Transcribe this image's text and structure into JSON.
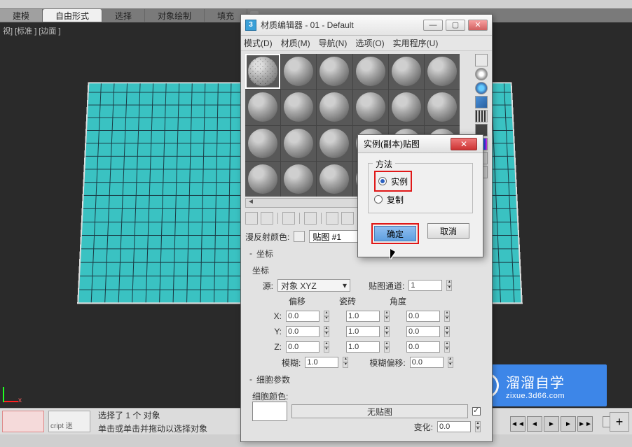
{
  "ribbon": {
    "tabs": [
      "建模",
      "自由形式",
      "选择",
      "对象绘制",
      "填充"
    ]
  },
  "viewport": {
    "label": "视] [标准 ] [边面 ]",
    "axis_x": "x"
  },
  "status": {
    "script_hint": "cript 迷",
    "line1": "选择了 1 个 对象",
    "line2": "单击或单击并拖动以选择对象"
  },
  "watermark": {
    "title": "溜溜自学",
    "url": "zixue.3d66.com"
  },
  "material_editor": {
    "title": "材质编辑器 - 01 - Default",
    "menu": [
      "模式(D)",
      "材质(M)",
      "导航(N)",
      "选项(O)",
      "实用程序(U)"
    ],
    "win_min": "—",
    "win_max": "▢",
    "win_close": "✕",
    "diffuse_label": "漫反射颜色:",
    "map_label": "贴图 #1",
    "coords": {
      "header": "坐标",
      "sub": "坐标",
      "src_label": "源:",
      "src_value": "对象 XYZ",
      "channel_label": "贴图通道:",
      "channel_value": "1",
      "cols": {
        "offset": "偏移",
        "tile": "瓷砖",
        "angle": "角度"
      },
      "rows": {
        "x": {
          "label": "X:",
          "off": "0.0",
          "tile": "1.0",
          "ang": "0.0"
        },
        "y": {
          "label": "Y:",
          "off": "0.0",
          "tile": "1.0",
          "ang": "0.0"
        },
        "z": {
          "label": "Z:",
          "off": "0.0",
          "tile": "1.0",
          "ang": "0.0"
        }
      },
      "blur_label": "模糊:",
      "blur_value": "1.0",
      "bluroff_label": "模糊偏移:",
      "bluroff_value": "0.0"
    },
    "cell": {
      "header": "细胞参数",
      "color_label": "细胞颜色:",
      "nomap": "无贴图",
      "var_label": "变化:",
      "var_value": "0.0"
    }
  },
  "instance_dialog": {
    "title": "实例(副本)贴图",
    "group": "方法",
    "opt_instance": "实例",
    "opt_copy": "复制",
    "ok": "确定",
    "cancel": "取消"
  }
}
